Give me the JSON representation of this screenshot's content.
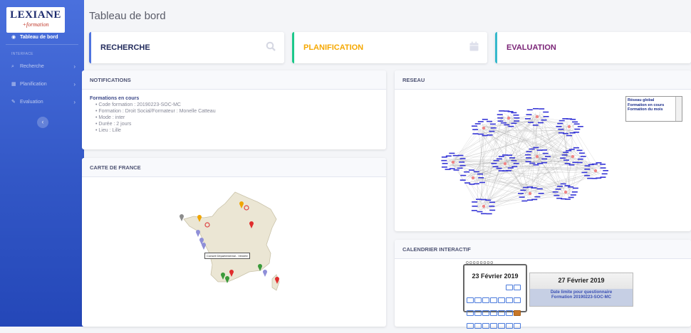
{
  "logo": {
    "brand": "LEXIANE",
    "sub": "+formation"
  },
  "sidebar": {
    "dashboard": "Tableau de bord",
    "heading": "INTERFACE",
    "items": [
      {
        "label": "Recherche",
        "icon": "search-icon"
      },
      {
        "label": "Planification",
        "icon": "table-icon"
      },
      {
        "label": "Evaluation",
        "icon": "pencil-icon"
      }
    ]
  },
  "page_title": "Tableau de bord",
  "top_cards": [
    {
      "label": "RECHERCHE",
      "color": "#4e73df",
      "text_color": "#222b5c",
      "icon": "search-icon"
    },
    {
      "label": "PLANIFICATION",
      "color": "#1cc88a",
      "text_color": "#f6a800",
      "icon": "calendar-icon"
    },
    {
      "label": "EVALUATION",
      "color": "#36b9cc",
      "text_color": "#7b2477"
    }
  ],
  "notifications": {
    "header": "NOTIFICATIONS",
    "title": "Formations en cours",
    "lines": [
      "Code formation : 20190223-SOC-MC",
      "Formation : Droit Social/Formateur : Monelle Catteau",
      "Mode : inter",
      "Durée : 2 jours",
      "Lieu : Lille"
    ]
  },
  "carte": {
    "header": "CARTE DE FRANCE",
    "tooltip": "Conseil Départemental - Vendée"
  },
  "reseau": {
    "header": "RESEAU",
    "legend": [
      "Réseau global",
      "Formation en cours",
      "Formation du mois"
    ]
  },
  "calendrier": {
    "header": "CALENDRIER INTERACTIF",
    "date": "23 Février 2019",
    "deadline_date": "27 Février 2019",
    "deadline_text": [
      "Date limite pour questionnaire",
      "Formation 20190223-SOC-MC"
    ]
  }
}
